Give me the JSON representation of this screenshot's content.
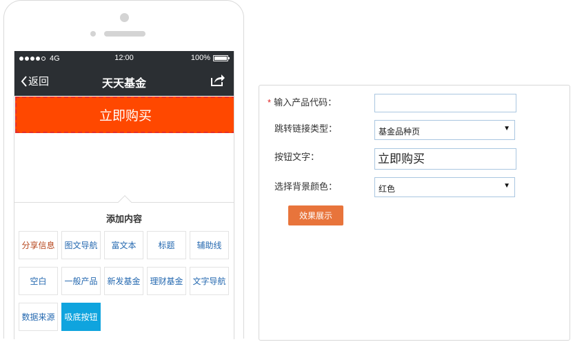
{
  "statusbar": {
    "carrier": "4G",
    "time": "12:00",
    "battery": "100%"
  },
  "navbar": {
    "back_label": "返回",
    "title": "天天基金",
    "share_icon": "share-icon"
  },
  "buy_button": {
    "label": "立即购买",
    "color": "#ff4800"
  },
  "add_panel": {
    "title": "添加内容",
    "items": [
      {
        "label": "分享信息"
      },
      {
        "label": "图文导航"
      },
      {
        "label": "富文本"
      },
      {
        "label": "标题"
      },
      {
        "label": "辅助线"
      },
      {
        "label": "空白"
      },
      {
        "label": "一般产品"
      },
      {
        "label": "新发基金"
      },
      {
        "label": "理财基金"
      },
      {
        "label": "文字导航"
      },
      {
        "label": "数据来源"
      },
      {
        "label": "吸底按钮",
        "active": true
      }
    ]
  },
  "form": {
    "product_code": {
      "required_mark": "*",
      "label": "输入产品代码：",
      "value": ""
    },
    "link_type": {
      "label": "跳转链接类型：",
      "selected": "基金品种页"
    },
    "button_text": {
      "label": "按钮文字：",
      "value": "立即购买"
    },
    "bg_color": {
      "label": "选择背景颜色：",
      "selected": "红色"
    },
    "preview_button": "效果展示"
  },
  "colors": {
    "bar_dark": "#2b2f33",
    "buy_orange": "#ff4800",
    "active_tile": "#0fa4de",
    "preview_orange": "#e8743b",
    "link_blue": "#2569b0"
  }
}
